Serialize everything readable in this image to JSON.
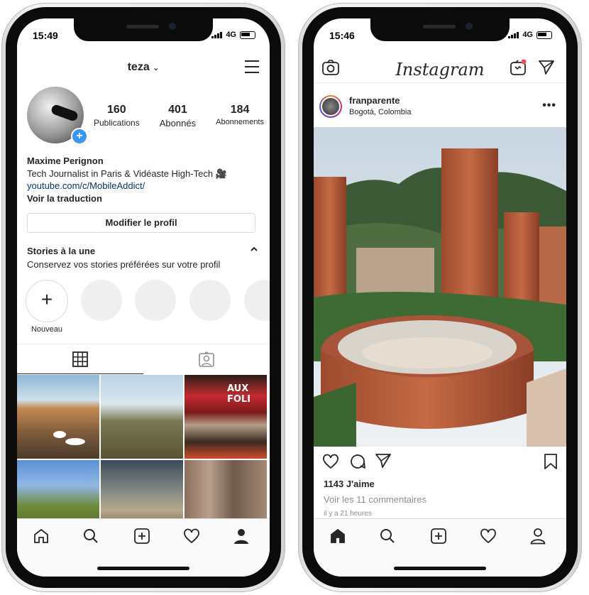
{
  "left_phone": {
    "status": {
      "time": "15:49",
      "network": "4G"
    },
    "header": {
      "username": "teza"
    },
    "stats": [
      {
        "num": "160",
        "label": "Publications"
      },
      {
        "num": "401",
        "label": "Abonnés"
      },
      {
        "num": "184",
        "label": "Abonnements"
      }
    ],
    "bio": {
      "name": "Maxime Perignon",
      "line1": "Tech Journalist in Paris & Vidéaste High-Tech 🎥",
      "link": "youtube.com/c/MobileAddict/",
      "translate": "Voir la traduction"
    },
    "edit_profile": "Modifier le profil",
    "highlights": {
      "title": "Stories à la une",
      "subtitle": "Conservez vos stories préférées sur votre profil",
      "new_label": "Nouveau"
    },
    "grid_photo_sign": "AUX FOLI"
  },
  "right_phone": {
    "status": {
      "time": "15:46",
      "network": "4G"
    },
    "brand": "Instagram",
    "post": {
      "username": "franparente",
      "location": "Bogotá, Colombia",
      "likes": "1143 J'aime",
      "comments": "Voir les 11 commentaires",
      "time_ago": "il y a 21 heures"
    }
  },
  "colors": {
    "accent_blue": "#3897f0",
    "link_blue": "#003569",
    "notify_red": "#ed4956"
  }
}
